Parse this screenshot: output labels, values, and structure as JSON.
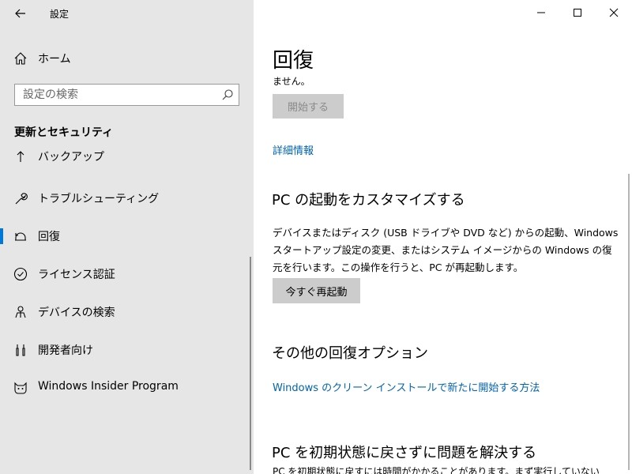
{
  "window": {
    "app_title": "設定"
  },
  "sidebar": {
    "home_label": "ホーム",
    "search_placeholder": "設定の検索",
    "section_heading": "更新とセキュリティ",
    "items": [
      {
        "label": "バックアップ",
        "icon": "backup-icon"
      },
      {
        "label": "トラブルシューティング",
        "icon": "wrench-icon"
      },
      {
        "label": "回復",
        "icon": "recovery-icon",
        "active": true
      },
      {
        "label": "ライセンス認証",
        "icon": "check-circle-icon"
      },
      {
        "label": "デバイスの検索",
        "icon": "person-pin-icon"
      },
      {
        "label": "開発者向け",
        "icon": "developer-tools-icon"
      },
      {
        "label": "Windows Insider Program",
        "icon": "insider-cat-icon"
      }
    ]
  },
  "main": {
    "title": "回復",
    "cut_text": "ません。",
    "start_button": "開始する",
    "details_link": "詳細情報",
    "custom_startup_heading": "PC の起動をカスタマイズする",
    "custom_startup_description": "デバイスまたはディスク (USB ドライブや DVD など) からの起動、Windows スタートアップ設定の変更、またはシステム イメージからの Windows の復元を行います。この操作を行うと、PC が再起動します。",
    "restart_button": "今すぐ再起動",
    "other_options_heading": "その他の回復オプション",
    "clean_install_link": "Windows のクリーン インストールで新たに開始する方法",
    "fix_heading": "PC を初期状態に戻さずに問題を解決する",
    "fix_description_cut": "PC を初期状態に戻すには時間がかかることがあります。まず実行していない"
  },
  "colors": {
    "sidebar_bg": "#e6e6e6",
    "accent": "#0078d7",
    "link": "#0063b1",
    "button_bg": "#cccccc"
  }
}
